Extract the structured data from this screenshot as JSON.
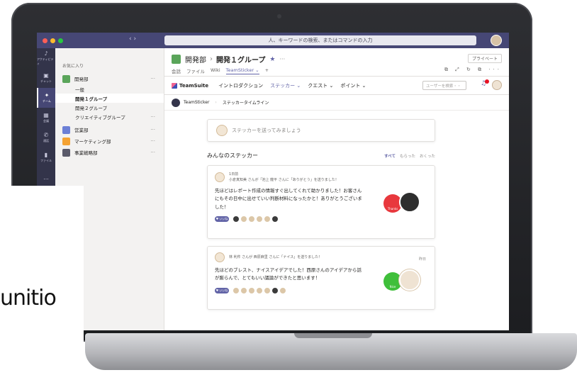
{
  "window": {
    "traffic_colors": [
      "#ff5f57",
      "#febc2e",
      "#28c840"
    ]
  },
  "search": {
    "placeholder": "人、キーワードの検索、またはコマンドの入力",
    "nav": "‹ ›"
  },
  "rail": [
    {
      "icon": "bell-icon",
      "label": "アクティビティ"
    },
    {
      "icon": "chat-icon",
      "label": "チャット"
    },
    {
      "icon": "teams-icon",
      "label": "チーム"
    },
    {
      "icon": "calendar-icon",
      "label": "会議"
    },
    {
      "icon": "phone-icon",
      "label": "通話"
    },
    {
      "icon": "file-icon",
      "label": "ファイル"
    },
    {
      "icon": "more-icon",
      "label": "..."
    }
  ],
  "sidebar": {
    "favorites_label": "お気に入り",
    "teams": [
      {
        "name": "開発部",
        "color": "#5aa55a",
        "channels": [
          "一般",
          "開発１グループ",
          "開発２グループ",
          "クリエイティブグループ"
        ]
      },
      {
        "name": "営業部",
        "color": "#6b7fd6",
        "channels": []
      },
      {
        "name": "マーケティング部",
        "color": "#f4a233",
        "channels": []
      },
      {
        "name": "事業戦略部",
        "color": "#5a5a6a",
        "channels": []
      }
    ]
  },
  "header": {
    "team": "開発部",
    "channel": "開発１グループ",
    "private_label": "プライベート",
    "tabs": [
      "会話",
      "ファイル",
      "Wiki",
      "TeamSticker ⌄",
      "+"
    ],
    "more": "···"
  },
  "app_nav": {
    "logo": "TeamSuite",
    "links": [
      "イントロダクション",
      "ステッカー ⌄",
      "クエスト ⌄",
      "ポイント ⌄"
    ],
    "user_search_placeholder": "ユーザーを検索・・"
  },
  "sub_nav": {
    "logo": "TeamSticker",
    "page": "ステッカータイムライン"
  },
  "compose": {
    "placeholder": "ステッカーを送ってみましょう"
  },
  "feed": {
    "title": "みんなのステッカー",
    "filters": [
      "すべて",
      "もらった",
      "おくった"
    ],
    "cards": [
      {
        "date": "1日前",
        "meta": "小倉真知美 さんが「池上 龍平 さんに「ありがとう」を送りました！",
        "body": "先ほどはレポート作成の情報すぐ出してくれて助かりました！お客さんにもその日中に出せていい判断材料になったかと！ありがとうございました！",
        "sticker_label": "Thanks"
      },
      {
        "date": "昨日",
        "meta": "林 利件 さんが 西原麻里 さんに「ナイス」を送りました！",
        "body": "先ほどのブレスト、ナイスアイデアでした！西原さんのアイデアから話が膨らんで、とてもいい議論ができたと思います！",
        "sticker_label": "Nice"
      }
    ]
  },
  "brand": {
    "logo_text": "unitio"
  }
}
